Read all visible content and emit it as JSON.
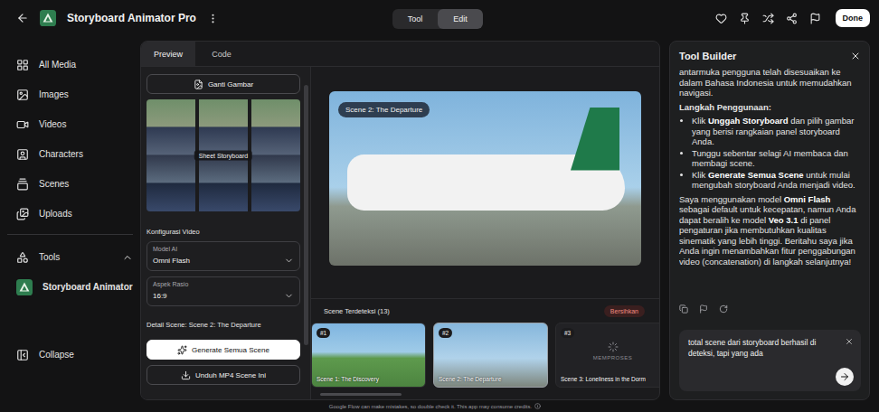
{
  "topbar": {
    "title": "Storyboard Animator Pro",
    "mode_tabs": [
      {
        "label": "Tool",
        "selected": false
      },
      {
        "label": "Edit",
        "selected": true
      }
    ],
    "done_button": "Done"
  },
  "sidebar": {
    "items": [
      {
        "label": "All Media",
        "icon": "grid"
      },
      {
        "label": "Images",
        "icon": "image"
      },
      {
        "label": "Videos",
        "icon": "video"
      },
      {
        "label": "Characters",
        "icon": "user"
      },
      {
        "label": "Scenes",
        "icon": "scenes"
      },
      {
        "label": "Uploads",
        "icon": "uploads"
      }
    ],
    "tools": {
      "label": "Tools",
      "expanded": true,
      "items": [
        {
          "label": "Storyboard Animator",
          "selected": true
        }
      ]
    },
    "collapse": "Collapse"
  },
  "center": {
    "tabs": [
      {
        "label": "Preview",
        "selected": true
      },
      {
        "label": "Code",
        "selected": false
      }
    ],
    "settings": {
      "replace_button": "Ganti Gambar",
      "storyboard_label": "Sheet Storyboard",
      "section_title": "Konfigurasi Video",
      "fields": [
        {
          "label": "Model AI",
          "value": "Omni Flash"
        },
        {
          "label": "Aspek Rasio",
          "value": "16:9"
        }
      ],
      "detail_title": "Detail Scene: Scene 2: The Departure",
      "generate_button": "Generate Semua Scene",
      "download_button": "Unduh MP4 Scene Ini"
    },
    "preview": {
      "badge": "Scene 2: The Departure"
    },
    "scenes": {
      "title": "Scene Terdeteksi (13)",
      "clear_button": "Bersihkan",
      "items": [
        {
          "number": "#1",
          "title": "Scene 1: The Discovery",
          "selected": false,
          "kind": "image",
          "status": ""
        },
        {
          "number": "#2",
          "title": "Scene 2: The Departure",
          "selected": true,
          "kind": "image",
          "status": ""
        },
        {
          "number": "#3",
          "title": "Scene 3: Loneliness in the Dorm",
          "selected": false,
          "kind": "processing",
          "status": "MEMPROSES"
        }
      ]
    }
  },
  "tool_builder": {
    "title": "Tool Builder",
    "intro": "antarmuka pengguna telah disesuaikan ke dalam Bahasa Indonesia untuk memudahkan navigasi.",
    "steps_title": "Langkah Penggunaan:",
    "steps": [
      [
        {
          "text": "Klik ",
          "bold": false
        },
        {
          "text": "Unggah Storyboard",
          "bold": true
        },
        {
          "text": " dan pilih gambar yang berisi rangkaian panel storyboard Anda.",
          "bold": false
        }
      ],
      [
        {
          "text": "Tunggu sebentar selagi AI membaca dan membagi scene.",
          "bold": false
        }
      ],
      [
        {
          "text": "Klik ",
          "bold": false
        },
        {
          "text": "Generate Semua Scene",
          "bold": true
        },
        {
          "text": " untuk mulai mengubah storyboard Anda menjadi video.",
          "bold": false
        }
      ]
    ],
    "closing": [
      {
        "text": "Saya menggunakan model ",
        "bold": false
      },
      {
        "text": "Omni Flash",
        "bold": true
      },
      {
        "text": " sebagai default untuk kecepatan, namun Anda dapat beralih ke model ",
        "bold": false
      },
      {
        "text": "Veo 3.1",
        "bold": true
      },
      {
        "text": " di panel pengaturan jika membutuhkan kualitas sinematik yang lebih tinggi. Beritahu saya jika Anda ingin menambahkan fitur penggabungan video (concatenation) di langkah selanjutnya!",
        "bold": false
      }
    ],
    "input": {
      "value": "total scene dari storyboard berhasil di deteksi, tapi yang ada"
    }
  },
  "footer": {
    "note": "Google Flow can make mistakes, so double check it. This app may consume credits."
  }
}
